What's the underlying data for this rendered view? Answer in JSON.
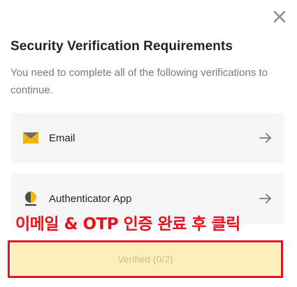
{
  "dialog": {
    "title": "Security Verification Requirements",
    "subtitle": "You need to complete all of the following verifications to continue."
  },
  "items": [
    {
      "label": "Email",
      "icon": "email-icon"
    },
    {
      "label": "Authenticator App",
      "icon": "authenticator-icon"
    }
  ],
  "annotation": {
    "text": "이메일 & OTP 인증 완료 후 클릭",
    "color": "#e8101a"
  },
  "verify_button": {
    "label": "Verified (0/2)",
    "background": "#fcefb9"
  },
  "colors": {
    "accent": "#f0b90b",
    "text_primary": "#1e2329",
    "text_secondary": "#707a8a",
    "item_bg": "#f5f5f5"
  }
}
